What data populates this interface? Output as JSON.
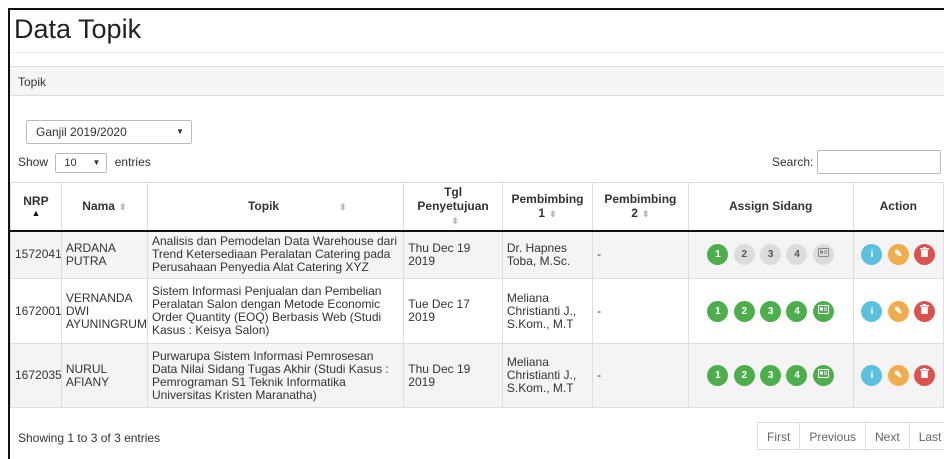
{
  "page": {
    "title": "Data Topik"
  },
  "panel": {
    "heading": "Topik"
  },
  "filters": {
    "semester": "Ganjil 2019/2020",
    "show_label": "Show",
    "entries_label": "entries",
    "page_length": "10",
    "search_label": "Search:",
    "search_value": ""
  },
  "table": {
    "headers": {
      "nrp": "NRP",
      "nama": "Nama",
      "topik": "Topik",
      "tgl": "Tgl Penyetujuan",
      "pembimbing1": "Pembimbing 1",
      "pembimbing2": "Pembimbing 2",
      "assign": "Assign Sidang",
      "action": "Action"
    },
    "rows": [
      {
        "nrp": "1572041",
        "nama": "ARDANA PUTRA",
        "topik": "Analisis dan Pemodelan Data Warehouse dari Trend Ketersediaan Peralatan Catering pada Perusahaan Penyedia Alat Catering XYZ",
        "tgl": "Thu Dec 19 2019",
        "pembimbing1": "Dr. Hapnes Toba, M.Sc.",
        "pembimbing2": "-",
        "sidang": [
          "1",
          "2",
          "3",
          "4"
        ],
        "sidang_states": [
          "done",
          "pending",
          "pending",
          "pending",
          "pending"
        ]
      },
      {
        "nrp": "1672001",
        "nama": "VERNANDA DWI AYUNINGRUM",
        "topik": "Sistem Informasi Penjualan dan Pembelian Peralatan Salon dengan Metode Economic Order Quantity (EOQ) Berbasis Web (Studi Kasus : Keisya Salon)",
        "tgl": "Tue Dec 17 2019",
        "pembimbing1": "Meliana Christianti J., S.Kom., M.T",
        "pembimbing2": "-",
        "sidang": [
          "1",
          "2",
          "3",
          "4"
        ],
        "sidang_states": [
          "done",
          "done",
          "done",
          "done",
          "done"
        ]
      },
      {
        "nrp": "1672035",
        "nama": "NURUL AFIANY",
        "topik": "Purwarupa Sistem Informasi Pemrosesan Data Nilai Sidang Tugas Akhir (Studi Kasus : Pemrograman S1 Teknik Informatika Universitas Kristen Maranatha)",
        "tgl": "Thu Dec 19 2019",
        "pembimbing1": "Meliana Christianti J., S.Kom., M.T",
        "pembimbing2": "-",
        "sidang": [
          "1",
          "2",
          "3",
          "4"
        ],
        "sidang_states": [
          "done",
          "done",
          "done",
          "done",
          "done"
        ]
      }
    ],
    "card_icon": "id-card-icon",
    "action_icons": [
      "info-icon",
      "pencil-icon",
      "trash-icon"
    ]
  },
  "footer": {
    "info": "Showing 1 to 3 of 3 entries",
    "pagination": [
      "First",
      "Previous",
      "Next",
      "Last"
    ]
  },
  "colors": {
    "done": "#4cae4c",
    "pending": "#dcdcdc",
    "info": "#5bc0de",
    "edit": "#f0ad4e",
    "delete": "#d9534f"
  }
}
